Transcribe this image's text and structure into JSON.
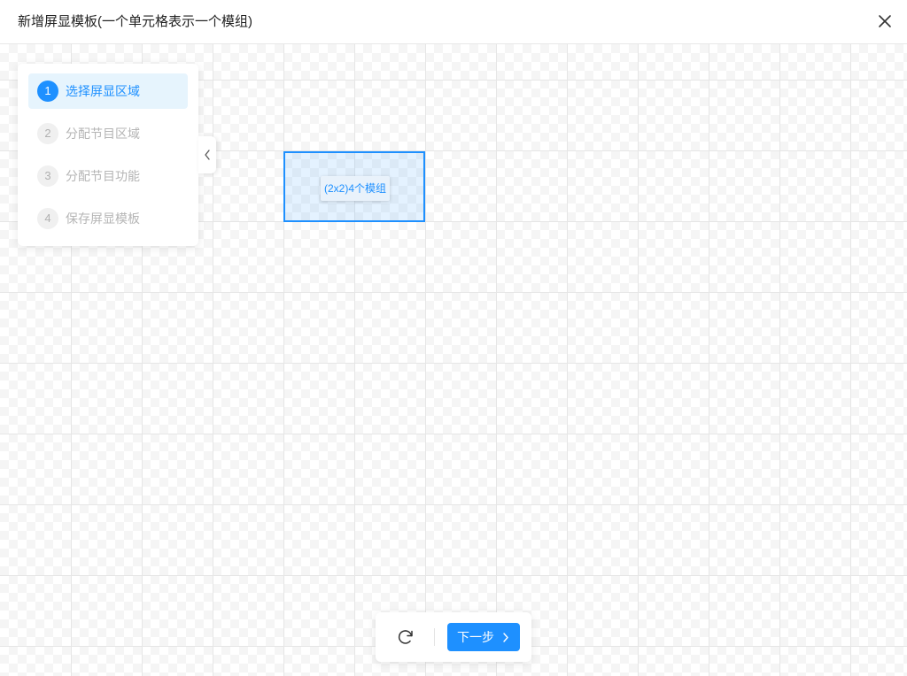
{
  "dialog": {
    "title": "新增屏显模板(一个单元格表示一个模组)",
    "close_icon": "close-icon"
  },
  "grid": {
    "columns": 13,
    "rows": 9,
    "line_color": "#e6e6e6"
  },
  "selection": {
    "label": "(2x2)4个模组",
    "color": "#1e90ff",
    "cols": 2,
    "rows": 2
  },
  "steps": {
    "items": [
      {
        "number": "1",
        "label": "选择屏显区域",
        "active": true
      },
      {
        "number": "2",
        "label": "分配节目区域",
        "active": false
      },
      {
        "number": "3",
        "label": "分配节目功能",
        "active": false
      },
      {
        "number": "4",
        "label": "保存屏显模板",
        "active": false
      }
    ],
    "collapse_icon": "chevron-left-icon"
  },
  "toolbar": {
    "refresh_icon": "refresh-icon",
    "next_label": "下一步",
    "next_icon": "chevron-right-icon"
  },
  "colors": {
    "accent": "#1e90ff",
    "active_step_bg": "#e6f4fd",
    "inactive_text": "#b5b5b5"
  }
}
